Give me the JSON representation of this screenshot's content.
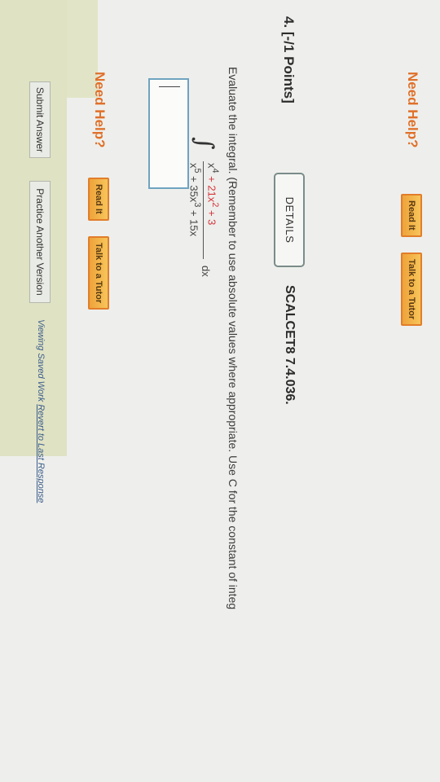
{
  "top_help": {
    "need_help": "Need Help?",
    "read_it": "Read It",
    "talk_to_tutor": "Talk to a Tutor"
  },
  "question": {
    "number_points": "4. [-/1 Points]",
    "details_button": "DETAILS",
    "source_code": "SCALCET8 7.4.036.",
    "prompt": "Evaluate the integral. (Remember to use absolute values where appropriate. Use C for the constant of integ",
    "integral": {
      "numerator_black": "x",
      "numerator_exp": "4",
      "numerator_red": " + 21x",
      "numerator_exp2": "2",
      "numerator_tail": " + 3",
      "denominator": "x",
      "den_exp1": "5",
      "den_mid": " + 35x",
      "den_exp2": "3",
      "den_tail": " + 15x",
      "dx": "dx"
    },
    "answer_value": ""
  },
  "bottom_help": {
    "need_help": "Need Help?",
    "read_it": "Read It",
    "talk_to_tutor": "Talk to a Tutor"
  },
  "actions": {
    "submit": "Submit Answer",
    "practice": "Practice Another Version",
    "status_prefix": "Viewing Saved Work ",
    "status_link": "Revert to Last Response"
  }
}
